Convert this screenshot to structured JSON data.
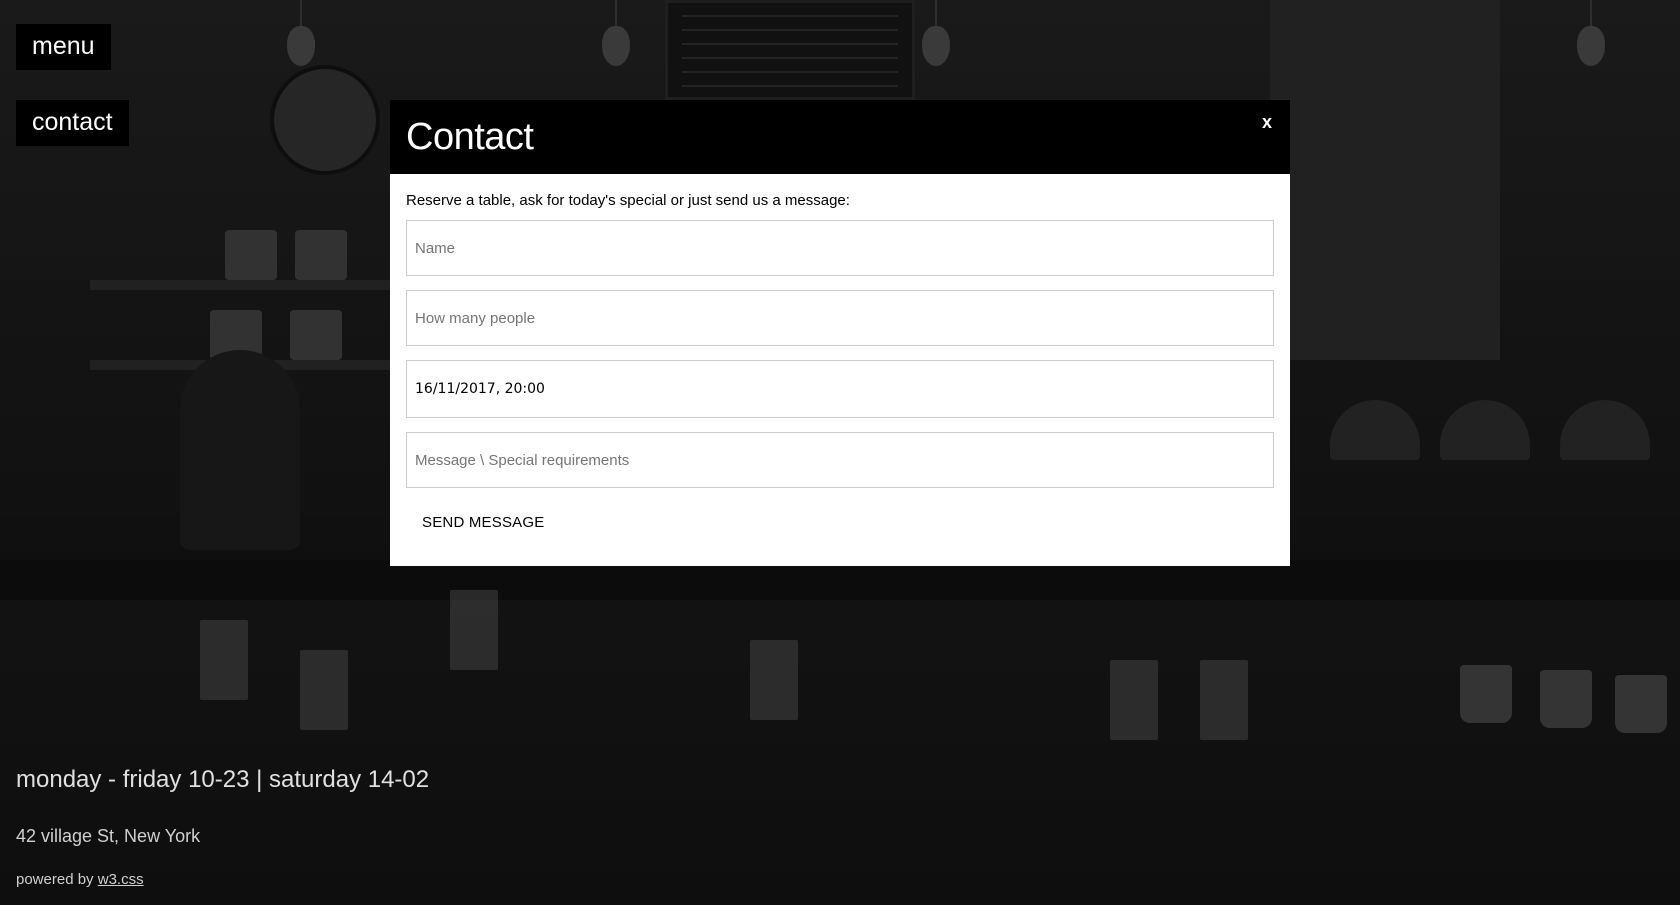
{
  "nav": {
    "menu_label": "menu",
    "contact_label": "contact"
  },
  "modal": {
    "title": "Contact",
    "close_label": "x",
    "intro": "Reserve a table, ask for today's special or just send us a message:",
    "fields": {
      "name_placeholder": "Name",
      "people_placeholder": "How many people",
      "datetime_value": "16/11/2017, 20:00",
      "message_placeholder": "Message \\ Special requirements"
    },
    "send_label": "SEND MESSAGE"
  },
  "footer": {
    "hours": "monday - friday 10-23 | saturday 14-02",
    "address": "42 village St, New York",
    "powered_prefix": "powered by",
    "powered_link": "w3.css"
  }
}
